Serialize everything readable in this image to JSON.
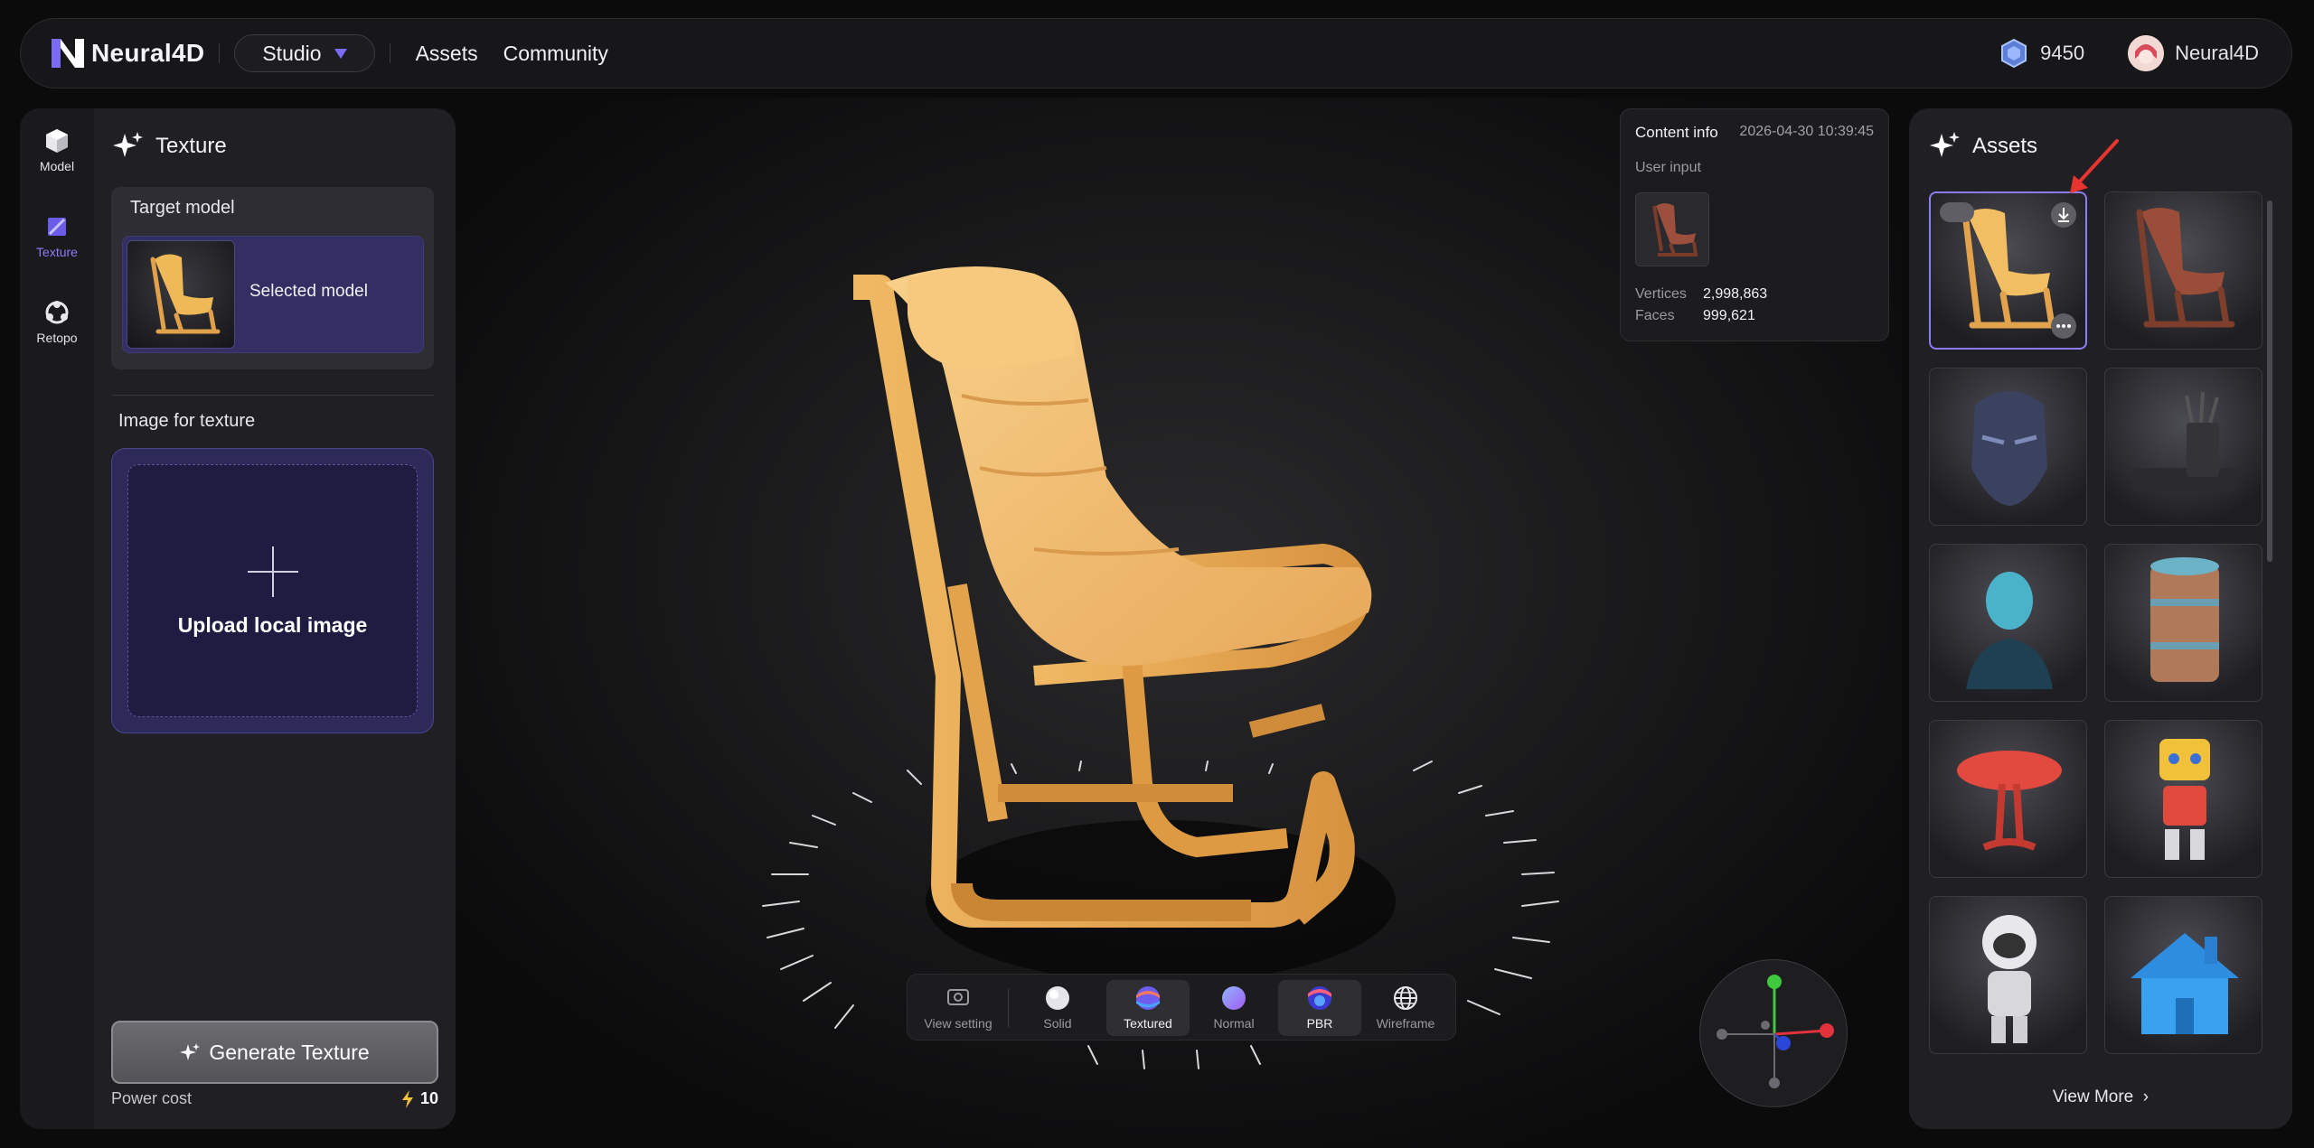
{
  "app": {
    "logo_text": "Neural4D",
    "mode_label": "Studio",
    "nav": [
      "Assets",
      "Community"
    ],
    "credits": "9450",
    "username": "Neural4D"
  },
  "tools": [
    {
      "label": "Model",
      "icon": "cube-icon"
    },
    {
      "label": "Texture",
      "icon": "brush-icon",
      "active": true
    },
    {
      "label": "Retopo",
      "icon": "retopo-icon"
    }
  ],
  "left_panel": {
    "title": "Texture",
    "target_label": "Target model",
    "target_name": "Selected model",
    "image_label": "Image for texture",
    "upload_label": "Upload local image",
    "generate_label": "Generate Texture",
    "power_label": "Power cost",
    "power_value": "10"
  },
  "info": {
    "title": "Content info",
    "date": "2026-04-30 10:39:45",
    "user_input_label": "User input",
    "vertices_label": "Vertices",
    "vertices_value": "2,998,863",
    "faces_label": "Faces",
    "faces_value": "999,621"
  },
  "view_toolbar": {
    "items": [
      {
        "label": "View setting",
        "icon": "view-setting-icon"
      },
      {
        "label": "Solid",
        "icon": "solid-sphere-icon"
      },
      {
        "label": "Textured",
        "icon": "textured-sphere-icon",
        "selected": true
      },
      {
        "label": "Normal",
        "icon": "normal-sphere-icon"
      },
      {
        "label": "PBR",
        "icon": "pbr-sphere-icon",
        "highlight": true
      },
      {
        "label": "Wireframe",
        "icon": "wireframe-globe-icon"
      }
    ]
  },
  "assets": {
    "title": "Assets",
    "view_more": "View More",
    "items": [
      "yellow-chair",
      "brown-chair",
      "helmet",
      "pen-holder",
      "bust",
      "barrel",
      "mushroom",
      "robot",
      "astronaut",
      "house"
    ]
  },
  "colors": {
    "accent": "#8b7cf7",
    "panel": "#202024",
    "upload_bg": "#2d2a5a"
  }
}
